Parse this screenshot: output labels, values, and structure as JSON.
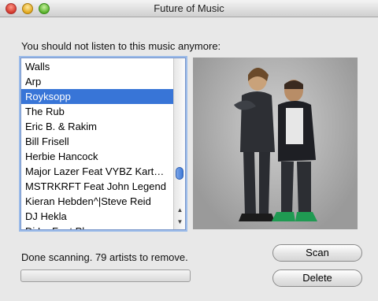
{
  "window": {
    "title": "Future of Music"
  },
  "prompt": "You should not listen to this music anymore:",
  "artists": [
    "Walls",
    "Arp",
    "Royksopp",
    "The Rub",
    "Eric B. & Rakim",
    "Bill Frisell",
    "Herbie Hancock",
    "Major Lazer Feat VYBZ Kart…",
    "MSTRKRFT Feat John Legend",
    "Kieran Hebden^|Steve Reid",
    "DJ Hekla",
    "Dj Lo Feat Phoo…"
  ],
  "selected_index": 2,
  "status": "Done scanning. 79 artists to remove.",
  "progress_value": 0,
  "buttons": {
    "scan": "Scan",
    "delete": "Delete"
  },
  "colors": {
    "selection": "#3875d7",
    "focus_ring": "#9bbbe9"
  },
  "icons": [
    "close-icon",
    "minimize-icon",
    "zoom-icon",
    "scroll-up-arrow-icon",
    "scroll-down-arrow-icon"
  ]
}
